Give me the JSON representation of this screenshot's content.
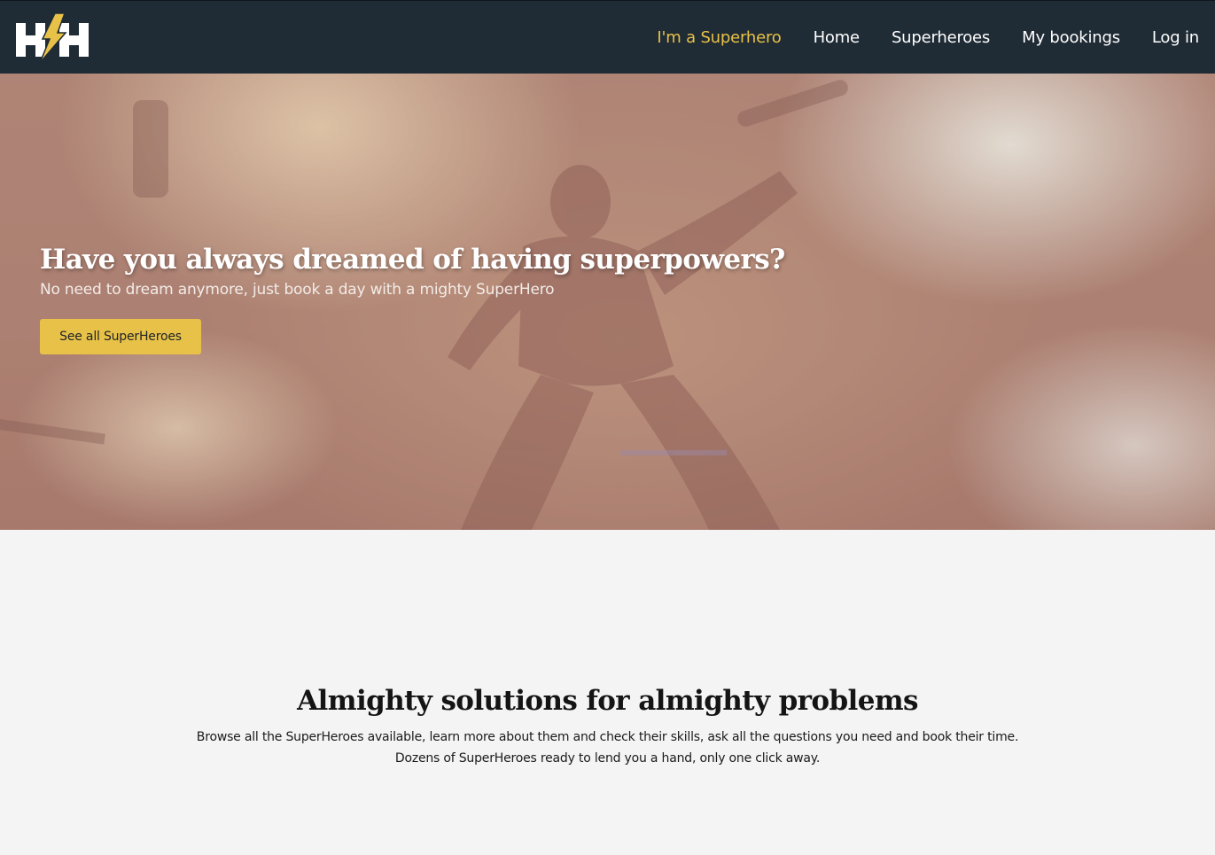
{
  "colors": {
    "navbar_bg": "#1f2b35",
    "accent": "#e8c248",
    "page_bg": "#f4f4f4"
  },
  "logo": {
    "icon": "hh-lightning-logo-icon"
  },
  "nav": {
    "items": [
      {
        "label": "I'm a Superhero"
      },
      {
        "label": "Home"
      },
      {
        "label": "Superheroes"
      },
      {
        "label": "My bookings"
      },
      {
        "label": "Log in"
      }
    ]
  },
  "hero": {
    "title": "Have you always dreamed of having superpowers?",
    "subtitle": "No need to dream anymore, just book a day with a mighty SuperHero",
    "button_label": "See all SuperHeroes"
  },
  "section": {
    "title": "Almighty solutions for almighty problems",
    "line1": "Browse all the SuperHeroes available, learn more about them and check their skills, ask all the questions you need and book their time.",
    "line2": "Dozens of SuperHeroes ready to lend you a hand, only one click away."
  }
}
